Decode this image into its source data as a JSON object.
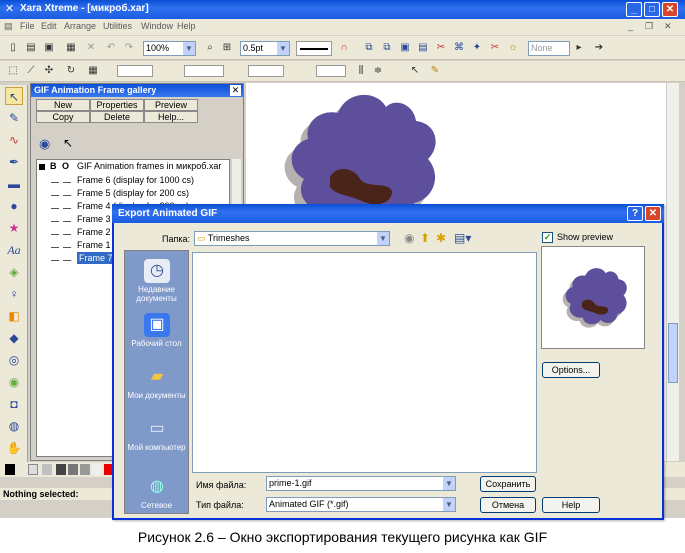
{
  "colors": {
    "xp_title": "#0a4fd6",
    "close_red": "#d8462a",
    "blob_fill": "#5d4f9b",
    "blob_mouth": "#4a2418",
    "selection": "#316ac5"
  },
  "app": {
    "title": "Xara Xtreme - [микроб.xar]",
    "menu": [
      "File",
      "Edit",
      "Arrange",
      "Utilities",
      "Window",
      "Help"
    ],
    "zoom": "100%",
    "line_width": "0.5pt",
    "none_combo": "None"
  },
  "gallery": {
    "title": "GIF Animation Frame gallery",
    "buttons": [
      "New",
      "Properties",
      "Preview",
      "Copy",
      "Delete",
      "Help..."
    ],
    "header_b": "B",
    "header_o": "O",
    "header_text": "GIF Animation frames in микроб.xar",
    "frames": [
      "Frame 6 (display for 1000 cs)",
      "Frame 5 (display for 200 cs)",
      "Frame 4 (display for 200 cs)",
      "Frame 3 (",
      "Frame 2 (",
      "Frame 1 (",
      "Frame 7 ("
    ],
    "selected_frame_index": 6
  },
  "status": {
    "text": "Nothing selected:"
  },
  "dialog": {
    "title": "Export Animated GIF",
    "folder_label": "Папка:",
    "folder_value": "Trimeshes",
    "places": [
      "Недавние документы",
      "Рабочий стол",
      "Мои документы",
      "Мой компьютер",
      "Сетевое"
    ],
    "filename_label": "Имя файла:",
    "filename_value": "prime-1.gif",
    "filetype_label": "Тип файла:",
    "filetype_value": "Animated GIF (*.gif)",
    "save_button": "Сохранить",
    "cancel_button": "Отмена",
    "help_button": "Help",
    "options_button": "Options...",
    "show_preview_label": "Show preview",
    "show_preview_checked": true
  },
  "caption": "Рисунок 2.6 – Окно экспортирования текущего рисунка как GIF"
}
